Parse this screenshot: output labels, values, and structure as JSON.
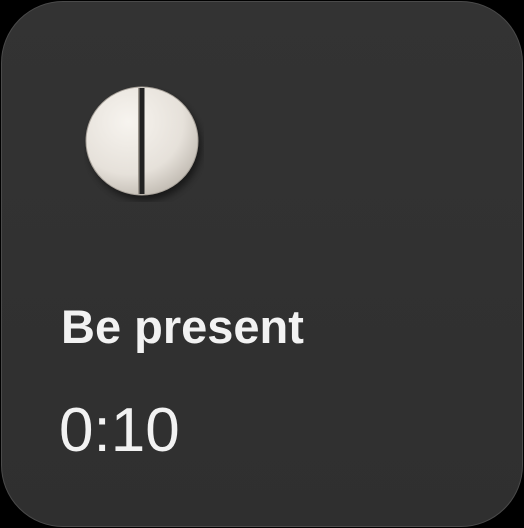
{
  "widget": {
    "icon": "pill-icon",
    "title": "Be present",
    "timer": "0:10"
  },
  "colors": {
    "background": "#000000",
    "card": "#333333",
    "text": "#f2f2f2",
    "pill": "#ece8e2"
  }
}
